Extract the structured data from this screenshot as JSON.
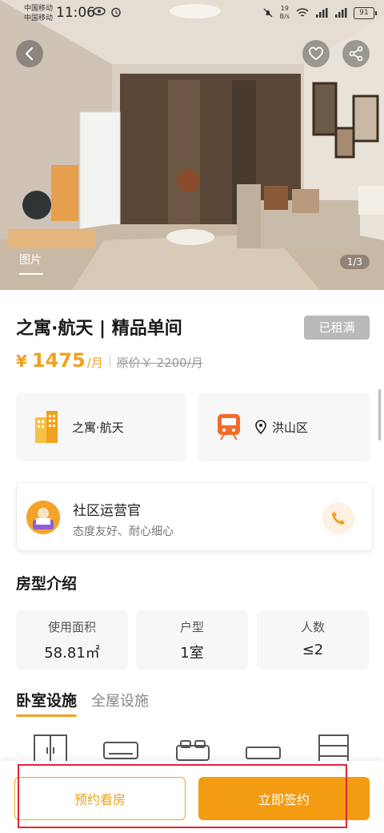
{
  "status_bar": {
    "carrier_1": "中国移动",
    "carrier_2": "中国移动",
    "time": "11:06",
    "net_speed_value": "19",
    "net_speed_unit": "B/s",
    "battery": "91"
  },
  "gallery": {
    "tab_label": "图片",
    "counter": "1/3"
  },
  "listing": {
    "title": "之寓·航天 | 精品单间",
    "status_badge": "已租满",
    "price_currency": "¥",
    "price": "1475",
    "price_unit": "/月",
    "original_price": "原价￥ 2200/月"
  },
  "info_cards": {
    "community": "之寓·航天",
    "district": "洪山区"
  },
  "agent": {
    "name": "社区运营官",
    "desc": "态度友好、耐心细心"
  },
  "room_intro": {
    "title": "房型介绍",
    "specs": [
      {
        "label": "使用面积",
        "value": "58.81㎡"
      },
      {
        "label": "户型",
        "value": "1室"
      },
      {
        "label": "人数",
        "value": "≤2"
      }
    ]
  },
  "facility_tabs": {
    "bedroom": "卧室设施",
    "whole": "全屋设施"
  },
  "actions": {
    "visit": "预约看房",
    "sign": "立即签约"
  },
  "colors": {
    "accent": "#f0a11e",
    "badge_gray": "#b9b9b9",
    "highlight_red": "#e0243a"
  }
}
